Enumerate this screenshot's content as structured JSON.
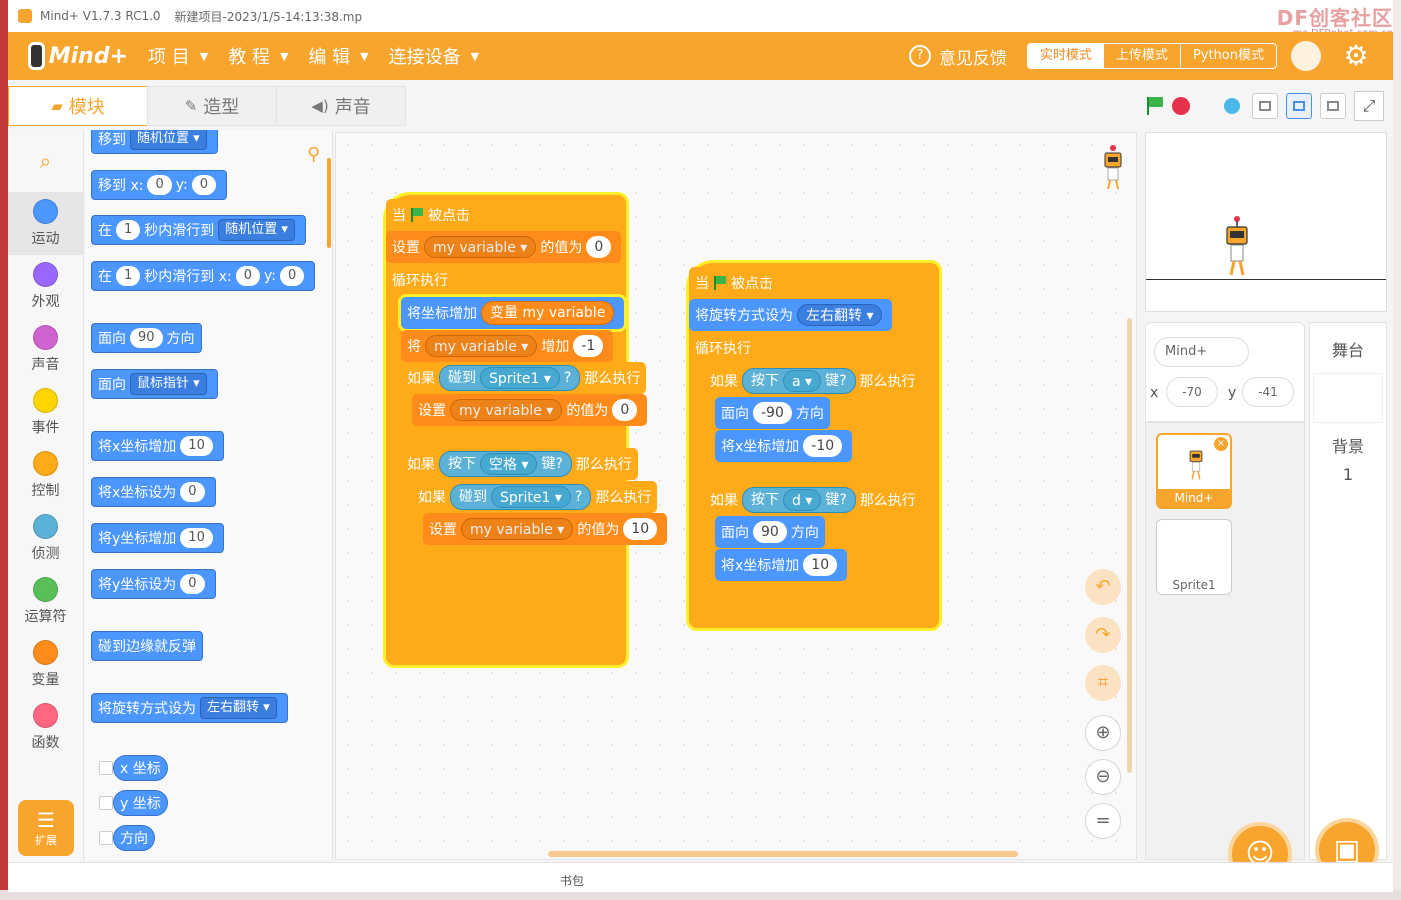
{
  "titlebar": {
    "app": "Mind+ V1.7.3 RC1.0",
    "project": "新建项目-2023/1/5-14:13:38.mp",
    "watermark_main": "DF创客社区",
    "watermark_sub": "mc.DFRobot.com.cn"
  },
  "menubar": {
    "logo": "Mind+",
    "items": [
      "项 目",
      "教 程",
      "编 辑",
      "连接设备"
    ],
    "feedback": "意见反馈",
    "modes": [
      "实时模式",
      "上传模式",
      "Python模式"
    ],
    "active_mode": "实时模式"
  },
  "tabs": [
    "模块",
    "造型",
    "声音"
  ],
  "categories": [
    {
      "label": "运动",
      "color": "#4c97ff"
    },
    {
      "label": "外观",
      "color": "#9966ff"
    },
    {
      "label": "声音",
      "color": "#cf63cf"
    },
    {
      "label": "事件",
      "color": "#ffd500"
    },
    {
      "label": "控制",
      "color": "#ffab19"
    },
    {
      "label": "侦测",
      "color": "#5cb1d6"
    },
    {
      "label": "运算符",
      "color": "#59c059"
    },
    {
      "label": "变量",
      "color": "#ff8c1a"
    },
    {
      "label": "函数",
      "color": "#ff6680"
    }
  ],
  "extension_label": "扩展",
  "palette": {
    "move_to": "移到",
    "random_pos": "随机位置",
    "move_to_xy": "移到 x:",
    "y_label": "y:",
    "zero": "0",
    "in": "在",
    "one": "1",
    "glide_to": "秒内滑行到",
    "glide_to_xy": "秒内滑行到 x:",
    "face": "面向",
    "ninety": "90",
    "direction": "方向",
    "face_towards": "面向",
    "mouse_pointer": "鼠标指针",
    "change_x": "将x坐标增加",
    "ten": "10",
    "set_x": "将x坐标设为",
    "change_y": "将y坐标增加",
    "set_y": "将y坐标设为",
    "bounce": "碰到边缘就反弹",
    "rotation_style": "将旋转方式设为",
    "left_right": "左右翻转",
    "x_pos": "x 坐标",
    "y_pos": "y 坐标",
    "dir_rep": "方向"
  },
  "script1": {
    "hat": "被点击",
    "when": "当",
    "set": "设置",
    "var": "my variable",
    "to_value": "的值为",
    "v0": "0",
    "forever": "循环执行",
    "change_coord": "将坐标增加",
    "var_rep": "变量 my variable",
    "change_var": "将",
    "by": "增加",
    "m1": "-1",
    "if": "如果",
    "touching": "碰到",
    "sprite1": "Sprite1",
    "q": "?",
    "then": "那么执行",
    "key_pressed": "按下",
    "space": "空格",
    "key_q": "键?",
    "v10": "10"
  },
  "script2": {
    "when": "当",
    "hat": "被点击",
    "rotation": "将旋转方式设为",
    "left_right": "左右翻转",
    "forever": "循环执行",
    "if": "如果",
    "key_pressed": "按下",
    "key_a": "a",
    "key_d": "d",
    "key_q": "键?",
    "then": "那么执行",
    "face": "面向",
    "dir_m90": "-90",
    "dir_90": "90",
    "direction": "方向",
    "change_x": "将x坐标增加",
    "vm10": "-10",
    "v10": "10"
  },
  "sprite_info": {
    "name": "Mind+",
    "x_label": "x",
    "x": "-70",
    "y_label": "y",
    "y": "-41"
  },
  "sprites": [
    "Mind+",
    "Sprite1"
  ],
  "stage_pane": {
    "title": "舞台",
    "backdrop_label": "背景",
    "backdrop_count": "1"
  },
  "status": {
    "backpack": "书包"
  }
}
